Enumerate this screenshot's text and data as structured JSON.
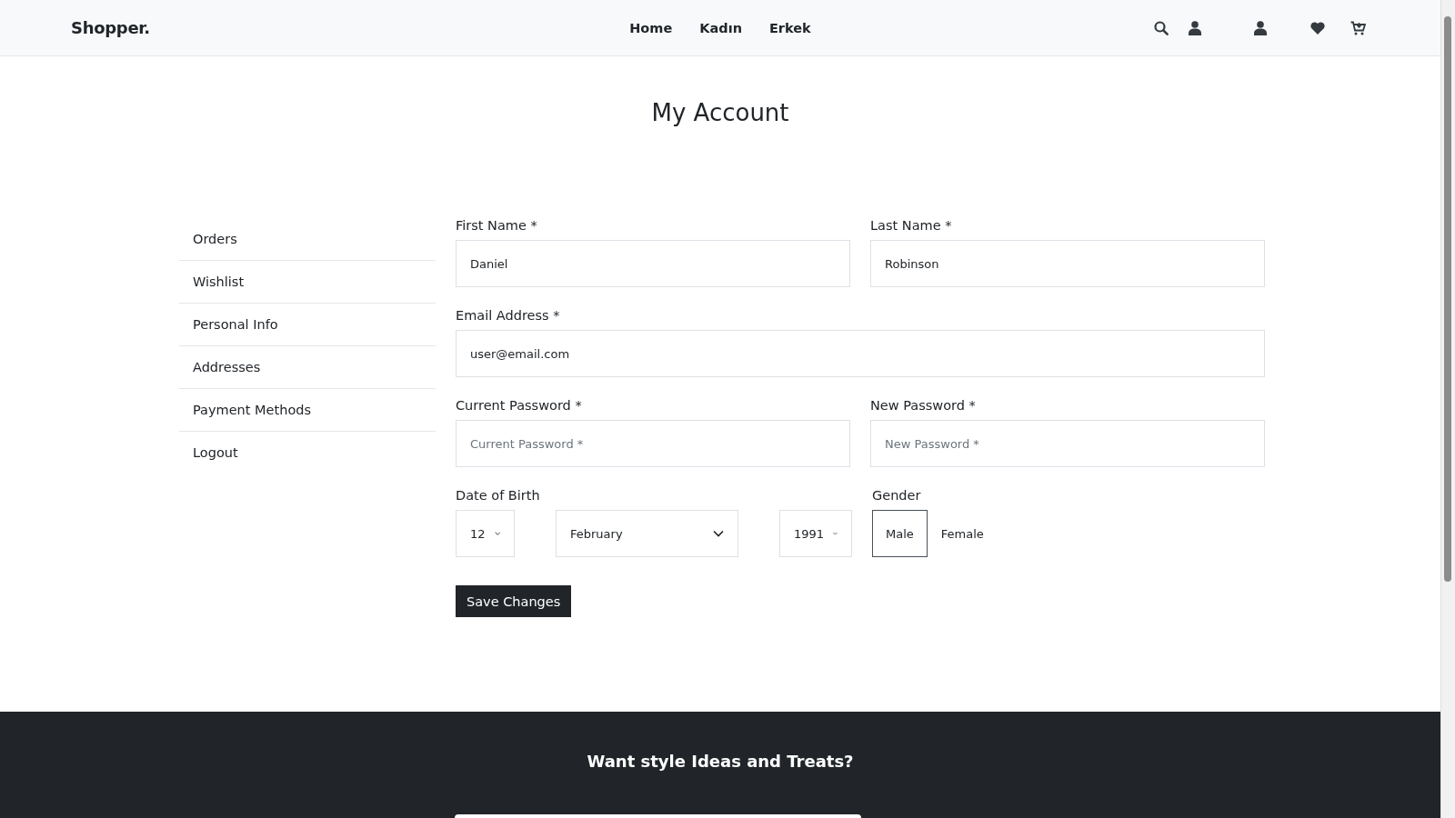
{
  "header": {
    "logo": "Shopper.",
    "nav": [
      {
        "label": "Home"
      },
      {
        "label": "Kadın"
      },
      {
        "label": "Erkek"
      }
    ]
  },
  "page_title": "My Account",
  "sidebar": {
    "items": [
      {
        "label": "Orders"
      },
      {
        "label": "Wishlist"
      },
      {
        "label": "Personal Info"
      },
      {
        "label": "Addresses"
      },
      {
        "label": "Payment Methods"
      },
      {
        "label": "Logout"
      }
    ]
  },
  "form": {
    "first_name": {
      "label": "First Name *",
      "value": "Daniel"
    },
    "last_name": {
      "label": "Last Name *",
      "value": "Robinson"
    },
    "email": {
      "label": "Email Address *",
      "value": "user@email.com"
    },
    "current_password": {
      "label": "Current Password *",
      "placeholder": "Current Password *"
    },
    "new_password": {
      "label": "New Password *",
      "placeholder": "New Password *"
    },
    "date_of_birth": {
      "label": "Date of Birth",
      "day": "12",
      "month": "February",
      "year": "1991"
    },
    "gender": {
      "label": "Gender",
      "options": [
        {
          "label": "Male",
          "selected": true
        },
        {
          "label": "Female",
          "selected": false
        }
      ]
    },
    "submit": "Save Changes"
  },
  "footer": {
    "heading": "Want style Ideas and Treats?"
  }
}
